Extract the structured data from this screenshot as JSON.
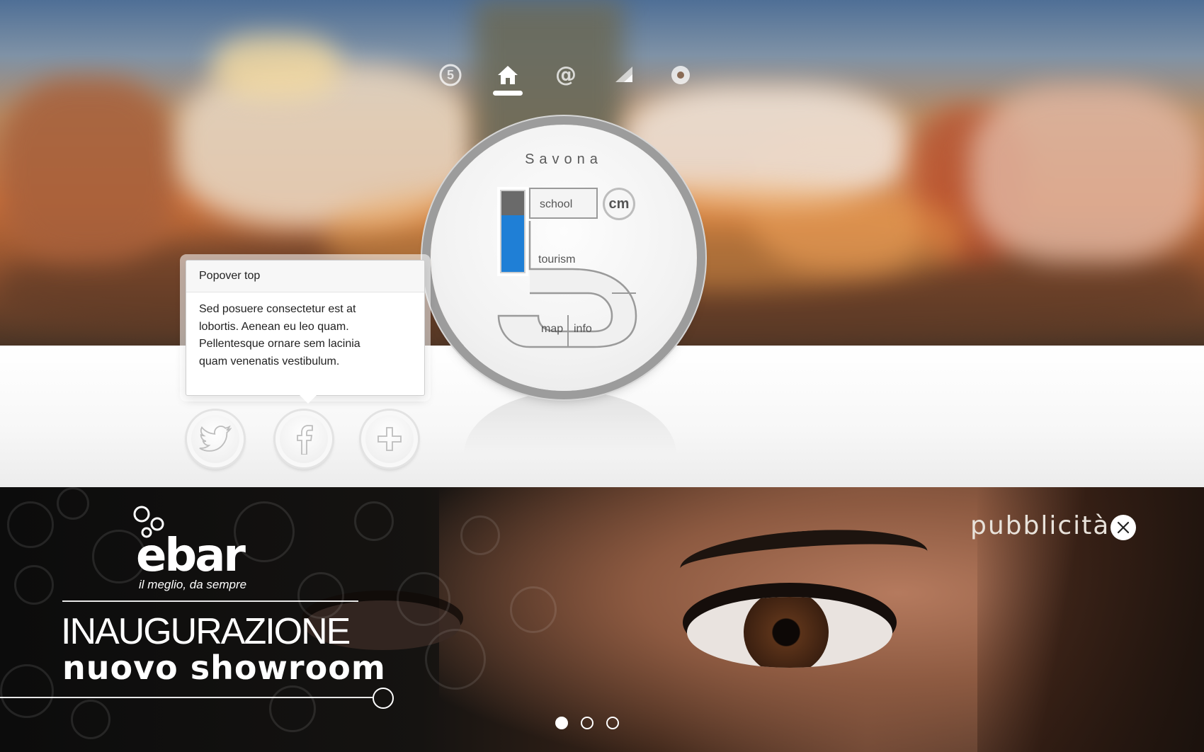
{
  "nav": {
    "items": [
      {
        "icon": "circled-five-icon",
        "active": false
      },
      {
        "icon": "home-icon",
        "active": true
      },
      {
        "icon": "at-sign-icon",
        "active": false
      },
      {
        "icon": "signal-triangle-icon",
        "active": false
      },
      {
        "icon": "radio-dot-icon",
        "active": false
      }
    ]
  },
  "dial": {
    "city": "Savona",
    "badge": "cm",
    "level": 0.7,
    "sections": {
      "school": "school",
      "tourism": "tourism",
      "map": "map",
      "info": "info"
    },
    "accent": "#1f7fd6"
  },
  "popover": {
    "title": "Popover top",
    "body_lines": [
      "Sed posuere consectetur est at",
      "lobortis. Aenean eu leo quam.",
      "Pellentesque ornare sem lacinia",
      "quam venenatis vestibulum."
    ]
  },
  "social": [
    {
      "icon": "twitter-icon"
    },
    {
      "icon": "facebook-icon"
    },
    {
      "icon": "plus-icon"
    }
  ],
  "ad": {
    "label": "pubblicità",
    "close_icon": "close-icon",
    "brand": "ebar",
    "tagline": "il meglio, da sempre",
    "headline": "INAUGURAZIONE",
    "subheadline": "nuovo showroom",
    "slides": [
      {
        "active": true
      },
      {
        "active": false
      },
      {
        "active": false
      }
    ]
  }
}
